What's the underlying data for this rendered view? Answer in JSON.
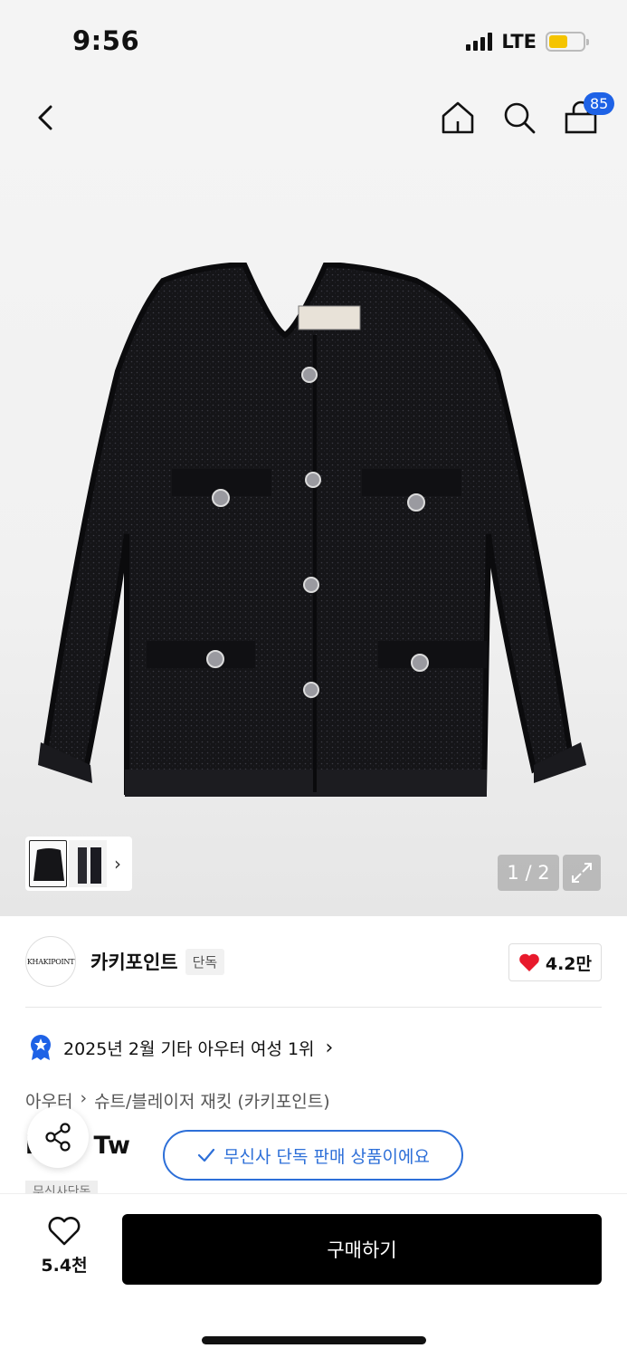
{
  "status": {
    "time": "9:56",
    "network": "LTE"
  },
  "nav": {
    "cart_count": "85"
  },
  "gallery": {
    "page_indicator": "1 / 2"
  },
  "brand": {
    "logo_text": "KHAKIPOINT",
    "name": "카키포인트",
    "tag": "단독",
    "likes": "4.2만"
  },
  "ranking": {
    "text": "2025년 2월 기타 아우터 여성 1위"
  },
  "breadcrumb": {
    "level1": "아우터",
    "level2": "슈트/블레이저 재킷 (카키포인트)"
  },
  "product": {
    "title_partial": "ique Tw",
    "exclusive_notice": "무신사 단독 판매 상품이에요",
    "sub_tag": "무신사단독"
  },
  "bottom": {
    "wish_count": "5.4천",
    "buy_label": "구매하기"
  },
  "colors": {
    "accent": "#2d6fd8",
    "badge": "#1e62e6",
    "heart": "#e8192c",
    "battery": "#f5c400"
  }
}
